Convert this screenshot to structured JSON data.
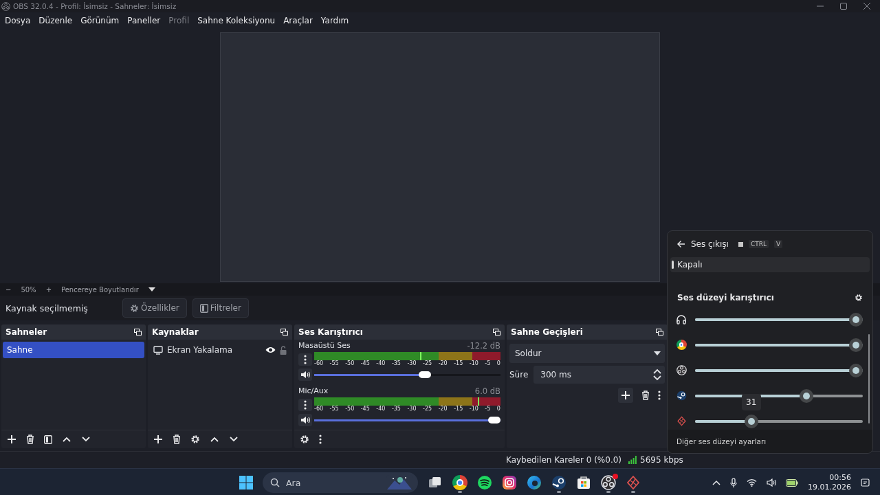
{
  "window": {
    "title": "OBS 32.0.4 - Profil: İsimsiz - Sahneler: İsimsiz"
  },
  "menu": [
    {
      "label": "Dosya",
      "disabled": false
    },
    {
      "label": "Düzenle",
      "disabled": false
    },
    {
      "label": "Görünüm",
      "disabled": false
    },
    {
      "label": "Paneller",
      "disabled": false
    },
    {
      "label": "Profil",
      "disabled": true
    },
    {
      "label": "Sahne Koleksiyonu",
      "disabled": false
    },
    {
      "label": "Araçlar",
      "disabled": false
    },
    {
      "label": "Yardım",
      "disabled": false
    }
  ],
  "preview": {
    "minus": "−",
    "zoom": "50%",
    "plus": "+",
    "mode": "Pencereye Boyutlandır"
  },
  "context_bar": {
    "status": "Kaynak seçilmemiş",
    "buttons": [
      {
        "kind": "properties",
        "label": "Özellikler"
      },
      {
        "kind": "filters",
        "label": "Filtreler"
      }
    ]
  },
  "scenes": {
    "title": "Sahneler",
    "items": [
      {
        "label": "Sahne",
        "selected": true
      }
    ]
  },
  "sources": {
    "title": "Kaynaklar",
    "items": [
      {
        "label": "Ekran Yakalama",
        "visible": true,
        "locked": false
      }
    ]
  },
  "mixer": {
    "title": "Ses Karıştırıcı",
    "channels": [
      {
        "name": "Masaüstü Ses",
        "reading": "-12.2 dB",
        "meter": {
          "level": 0.57
        },
        "scale": [
          "-60",
          "-55",
          "-50",
          "-45",
          "-40",
          "-35",
          "-30",
          "-25",
          "-20",
          "-15",
          "-10",
          "-5",
          "0"
        ],
        "volume": {
          "level": 0.6
        }
      },
      {
        "name": "Mic/Aux",
        "reading": "6.0 dB",
        "meter": {
          "level": 0.88
        },
        "scale": [
          "-60",
          "-55",
          "-50",
          "-45",
          "-40",
          "-35",
          "-30",
          "-25",
          "-20",
          "-15",
          "-10",
          "-5",
          "0"
        ],
        "volume": {
          "level": 1
        }
      }
    ]
  },
  "transitions": {
    "title": "Sahne Geçişleri",
    "selected": "Soldur",
    "duration_label": "Süre",
    "duration": "300 ms"
  },
  "status_bar": {
    "dropped_frames": "Kaybedilen Kareler 0 (%0.0)",
    "bitrate": "5695 kbps"
  },
  "taskbar": {
    "search": {
      "placeholder": "Ara"
    },
    "apps": [
      {
        "kind": "taskview",
        "running": false,
        "notification": false
      },
      {
        "kind": "chrome",
        "running": true,
        "notification": false
      },
      {
        "kind": "spotify",
        "running": false,
        "notification": false
      },
      {
        "kind": "instagram",
        "running": false,
        "notification": false
      },
      {
        "kind": "edge",
        "running": false,
        "notification": false
      },
      {
        "kind": "steam",
        "running": true,
        "notification": false
      },
      {
        "kind": "store",
        "running": false,
        "notification": false
      },
      {
        "kind": "obs",
        "running": true,
        "notification": true
      },
      {
        "kind": "app",
        "running": true,
        "notification": false
      }
    ],
    "clock": {
      "time": "00:56",
      "date": "19.01.2026"
    }
  },
  "volume_flyout": {
    "title": "Ses çıkışı",
    "keys": [
      "CTRL",
      "V"
    ],
    "output": {
      "label": "Kapalı",
      "selected": true
    },
    "mixer_title": "Ses düzeyi karıştırıcı",
    "apps": [
      {
        "kind": "headphones",
        "level": 1
      },
      {
        "kind": "chrome",
        "level": 1
      },
      {
        "kind": "obs",
        "level": 1
      },
      {
        "kind": "steam",
        "level": 0.68
      },
      {
        "kind": "app",
        "level": 0.32,
        "tooltip": "31"
      }
    ],
    "link": "Diğer ses düzeyi ayarları"
  }
}
